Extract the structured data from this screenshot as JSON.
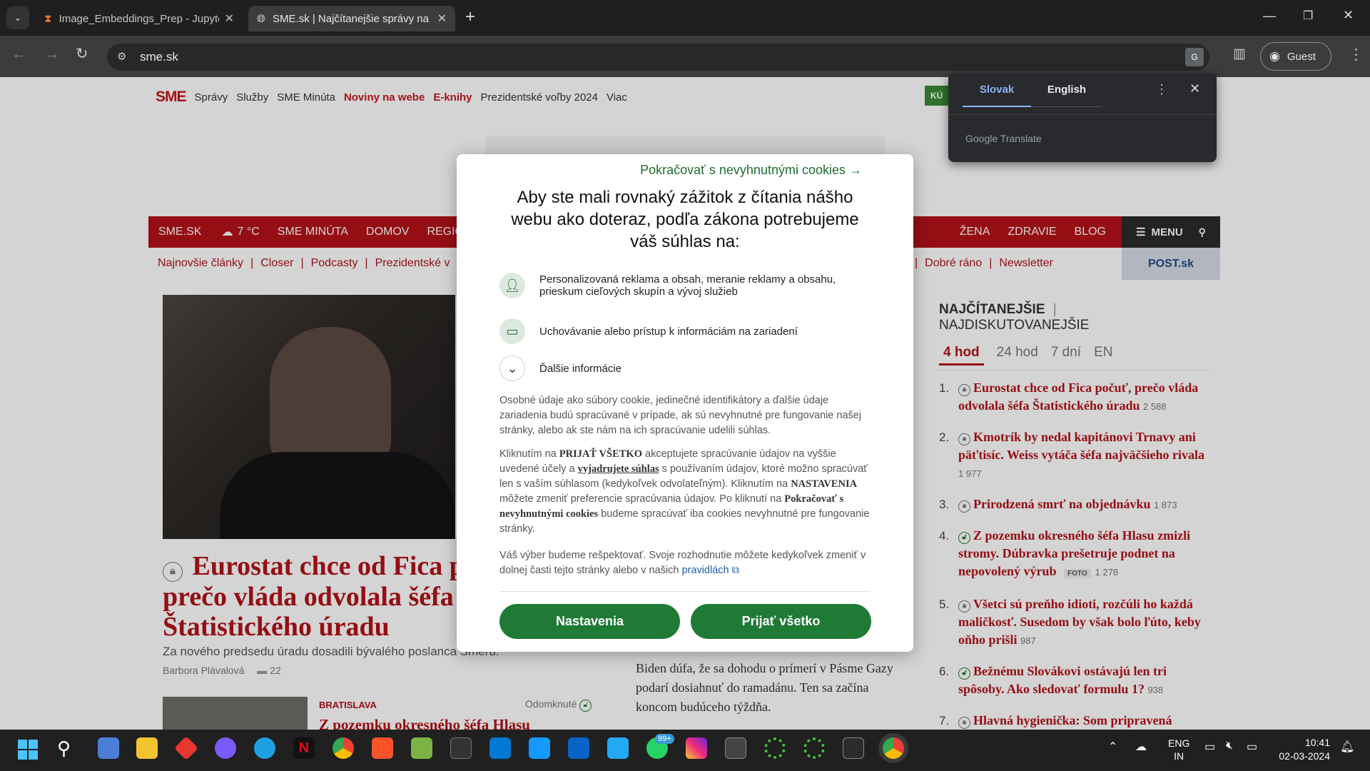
{
  "browser": {
    "tabs": [
      {
        "title": "Image_Embeddings_Prep - Jupyter",
        "active": false
      },
      {
        "title": "SME.sk | Najčítanejšie správy na Slovensku",
        "active": true
      }
    ],
    "url": "sme.sk",
    "profile_label": "Guest"
  },
  "translate": {
    "lang_from": "Slovak",
    "lang_to": "English",
    "provider": "Google Translate"
  },
  "site": {
    "logo": "SME",
    "top_nav": [
      "Správy",
      "Služby",
      "SME Minúta",
      "Noviny na webe",
      "E-knihy",
      "Prezidentské voľby 2024",
      "Viac"
    ],
    "red_nav": [
      "SME.SK",
      "7 °C",
      "SME MINÚTA",
      "DOMOV",
      "REGIÓN"
    ],
    "red_nav_right": [
      "ŽENA",
      "ZDRAVIE",
      "BLOG"
    ],
    "menu_label": "MENU",
    "sub_nav_left": [
      "Najnovšie články",
      "Closer",
      "Podcasty",
      "Prezidentské v"
    ],
    "sub_nav_right": [
      "Dobré ráno",
      "Newsletter"
    ],
    "post_label": "POST.sk",
    "kupit_label": "KÚ"
  },
  "article": {
    "headline": "Eurostat chce od Fica počuť, prečo vláda odvolala šéfa Štatistického úradu",
    "perex": "Za nového predsedu úradu dosadili bývalého poslanca Smeru.",
    "author": "Barbora Plávalová",
    "comments": "22",
    "second_tag": "BRATISLAVA",
    "second_title": "Z pozemku okresného šéfa Hlasu",
    "unlocked": "Odomknuté",
    "middle_text": "Biden dúfa, že sa dohodu o prímerí v Pásme Gazy podarí dosiahnuť do ramadánu. Ten sa začína koncom budúceho týždňa."
  },
  "most_read": {
    "tab_active": "NAJČÍTANEJŠIE",
    "tab_other": "NAJDISKUTOVANEJŠIE",
    "periods": [
      "4 hod",
      "24 hod",
      "7 dní",
      "EN"
    ],
    "items": [
      {
        "n": "1.",
        "title": "Eurostat chce od Fica počuť, prečo vláda odvolala šéfa Štatistického úradu",
        "count": "2 588",
        "lock": "grey"
      },
      {
        "n": "2.",
        "title": "Kmotrík by nedal kapitánovi Trnavy ani päťtisíc. Weiss vytáča šéfa najväčšieho rivala",
        "count": "1 977",
        "lock": "grey"
      },
      {
        "n": "3.",
        "title": "Prirodzená smrť na objednávku",
        "count": "1 873",
        "lock": "grey"
      },
      {
        "n": "4.",
        "title": "Z pozemku okresného šéfa Hlasu zmizli stromy. Dúbravka prešetruje podnet na nepovolený výrub",
        "count": "1 278",
        "lock": "green",
        "badge": "FOTO"
      },
      {
        "n": "5.",
        "title": "Všetci sú preňho idioti, rozčúli ho každá maličkosť. Susedom by však bolo ľúto, keby oňho prišli",
        "count": "987",
        "lock": "grey"
      },
      {
        "n": "6.",
        "title": "Bežnému Slovákovi ostávajú len tri spôsoby. Ako sledovať formulu 1?",
        "count": "938",
        "lock": "green"
      },
      {
        "n": "7.",
        "title": "Hlavná hygienička: Som pripravená oponovať splnomocnencovi na",
        "count": "",
        "lock": "grey"
      }
    ]
  },
  "consent": {
    "essential_link": "Pokračovať s nevyhnutnými cookies →",
    "title": "Aby ste mali rovnaký zážitok z čítania nášho webu ako doteraz, podľa zákona potrebujeme váš súhlas na:",
    "purpose1": "Personalizovaná reklama a obsah, meranie reklamy a obsahu, prieskum cieľových skupín a vývoj služieb",
    "purpose2": "Uchovávanie alebo prístup k informáciám na zariadení",
    "more_info": "Ďalšie informácie",
    "p1": "Osobné údaje ako súbory cookie, jedinečné identifikátory a ďalšie údaje zariadenia budú spracúvané v prípade, ak sú nevyhnutné pre fungovanie našej stránky, alebo ak ste nám na ich spracúvanie udelili súhlas.",
    "p2_a": "Kliknutím na ",
    "p2_b": "PRIJAŤ VŠETKO",
    "p2_c": " akceptujete spracúvanie údajov na vyššie uvedené účely a ",
    "p2_d": "vyjadrujete súhlas",
    "p2_e": " s používaním údajov, ktoré možno spracúvať len s vaším súhlasom (kedykoľvek odvolateľným). Kliknutím na ",
    "p2_f": "NASTAVENIA",
    "p2_g": " môžete zmeniť preferencie spracúvania údajov. Po kliknutí na ",
    "p2_h": "Pokračovať s nevyhnutnými cookies",
    "p2_i": " budeme spracúvať iba cookies nevyhnutné pre fungovanie stránky.",
    "p3": "Váš výber budeme rešpektovať. Svoje rozhodnutie môžete kedykoľvek zmeniť v dolnej časti tejto stránky alebo v našich ",
    "p3_link": "pravidlách",
    "btn_settings": "Nastavenia",
    "btn_accept": "Prijať všetko"
  },
  "taskbar": {
    "lang1": "ENG",
    "lang2": "IN",
    "time": "10:41",
    "date": "02-03-2024",
    "badge": "99+"
  }
}
